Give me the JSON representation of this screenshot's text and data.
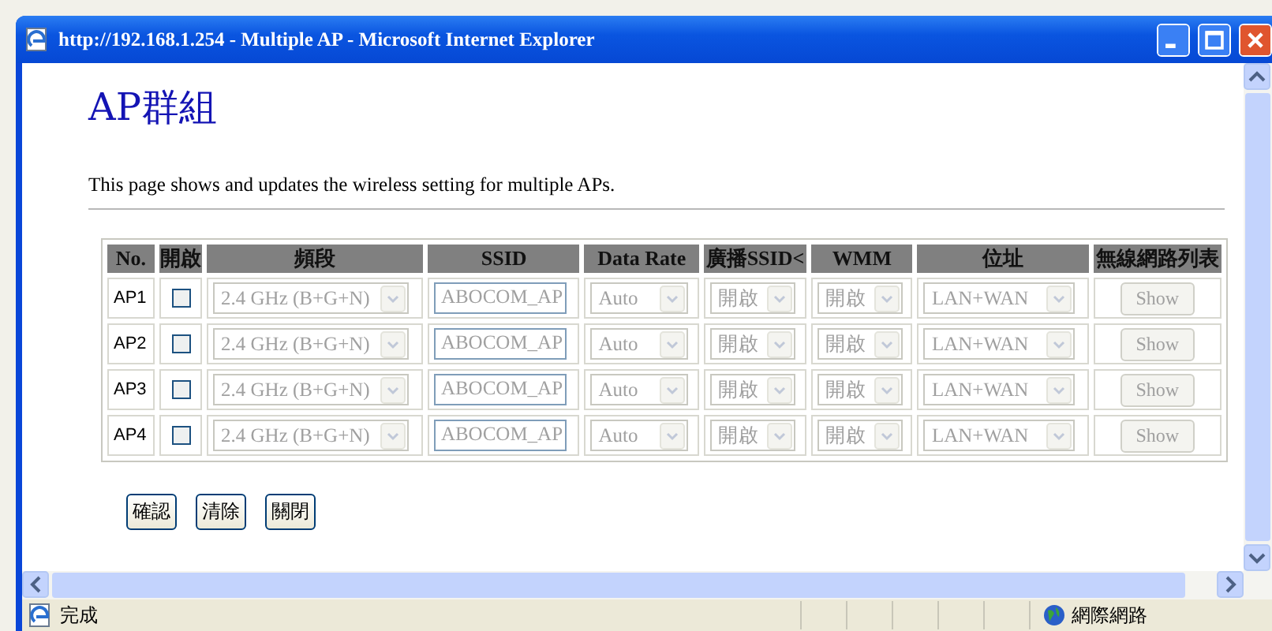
{
  "window": {
    "title": "http://192.168.1.254 - Multiple AP - Microsoft Internet Explorer"
  },
  "page": {
    "heading": "AP群組",
    "description": "This page shows and updates the wireless setting for multiple APs."
  },
  "table": {
    "columns": [
      "No.",
      "開啟",
      "頻段",
      "SSID",
      "Data Rate",
      "廣播SSID<",
      "WMM",
      "位址",
      "無線網路列表"
    ],
    "rows": [
      {
        "no": "AP1",
        "checked": false,
        "disabled": true,
        "band": "2.4 GHz (B+G+N)",
        "ssid": "ABOCOM_AP",
        "rate": "Auto",
        "broadcast": "開啟",
        "wmm": "開啟",
        "address": "LAN+WAN",
        "list": "Show"
      },
      {
        "no": "AP2",
        "checked": false,
        "disabled": true,
        "band": "2.4 GHz (B+G+N)",
        "ssid": "ABOCOM_AP",
        "rate": "Auto",
        "broadcast": "開啟",
        "wmm": "開啟",
        "address": "LAN+WAN",
        "list": "Show"
      },
      {
        "no": "AP3",
        "checked": false,
        "disabled": true,
        "band": "2.4 GHz (B+G+N)",
        "ssid": "ABOCOM_AP",
        "rate": "Auto",
        "broadcast": "開啟",
        "wmm": "開啟",
        "address": "LAN+WAN",
        "list": "Show"
      },
      {
        "no": "AP4",
        "checked": false,
        "disabled": true,
        "band": "2.4 GHz (B+G+N)",
        "ssid": "ABOCOM_AP",
        "rate": "Auto",
        "broadcast": "開啟",
        "wmm": "開啟",
        "address": "LAN+WAN",
        "list": "Show"
      }
    ]
  },
  "buttons": [
    "確認",
    "清除",
    "關閉"
  ],
  "status_bar": {
    "status": "完成",
    "zone": "網際網路"
  }
}
